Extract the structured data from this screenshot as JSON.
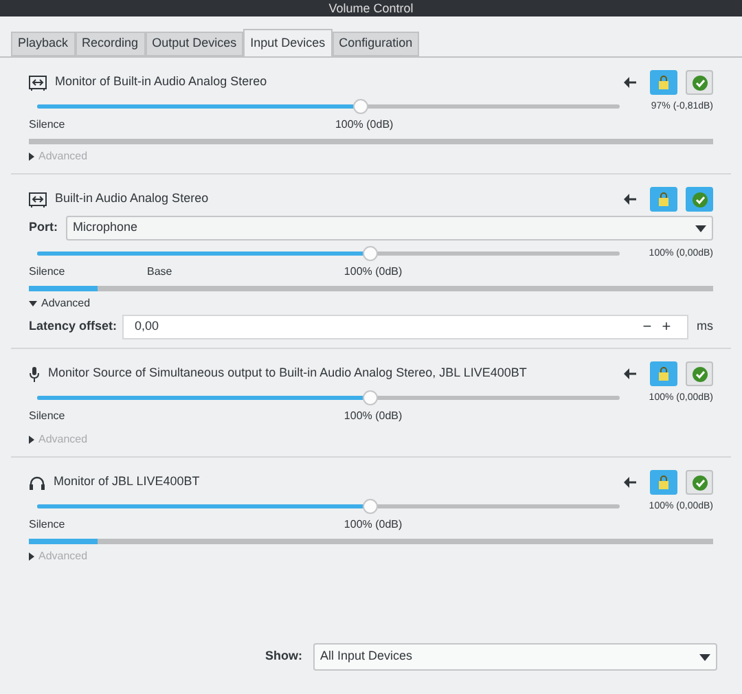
{
  "window": {
    "title": "Volume Control"
  },
  "tabs": [
    {
      "label": "Playback",
      "selected": false
    },
    {
      "label": "Recording",
      "selected": false
    },
    {
      "label": "Output Devices",
      "selected": false
    },
    {
      "label": "Input Devices",
      "selected": true
    },
    {
      "label": "Configuration",
      "selected": false
    }
  ],
  "devices": [
    {
      "kind": "card",
      "name": "Monitor of Built-in Audio Analog Stereo",
      "locked": true,
      "default": false,
      "level": 0.555,
      "reading": "97% (-0,81dB)",
      "scale": [
        {
          "kind": "min",
          "label": "Silence"
        },
        {
          "kind": "norm",
          "label": "100% (0dB)"
        }
      ],
      "meter": {
        "level": 0.0
      },
      "advanced": {
        "label": "Advanced",
        "expanded": false
      }
    },
    {
      "kind": "card",
      "name": "Built-in Audio Analog Stereo",
      "locked": true,
      "default": true,
      "port": {
        "label": "Port:",
        "value": "Microphone"
      },
      "level": 0.57,
      "reading": "100% (0,00dB)",
      "scale": [
        {
          "kind": "min",
          "label": "Silence"
        },
        {
          "kind": "base",
          "label": "Base"
        },
        {
          "kind": "norm",
          "label": "100% (0dB)"
        }
      ],
      "meter": {
        "level": 0.1
      },
      "advanced": {
        "label": "Advanced",
        "expanded": true,
        "latency_label": "Latency offset:",
        "latency_value": "0,00",
        "minus": "−",
        "plus": "+",
        "unit": "ms"
      }
    },
    {
      "kind": "mic",
      "name": "Monitor Source of Simultaneous output to Built-in Audio Analog Stereo, JBL LIVE400BT",
      "locked": true,
      "default": false,
      "level": 0.57,
      "reading": "100% (0,00dB)",
      "scale": [
        {
          "kind": "min",
          "label": "Silence"
        },
        {
          "kind": "norm",
          "label": "100% (0dB)"
        }
      ],
      "advanced": {
        "label": "Advanced",
        "expanded": false
      }
    },
    {
      "kind": "headphones",
      "name": "Monitor of JBL LIVE400BT",
      "locked": true,
      "default": false,
      "level": 0.57,
      "reading": "100% (0,00dB)",
      "scale": [
        {
          "kind": "min",
          "label": "Silence"
        },
        {
          "kind": "norm",
          "label": "100% (0dB)"
        }
      ],
      "meter": {
        "level": 0.1
      },
      "advanced": {
        "label": "Advanced",
        "expanded": false
      }
    }
  ],
  "show": {
    "label": "Show:",
    "value": "All Input Devices"
  }
}
